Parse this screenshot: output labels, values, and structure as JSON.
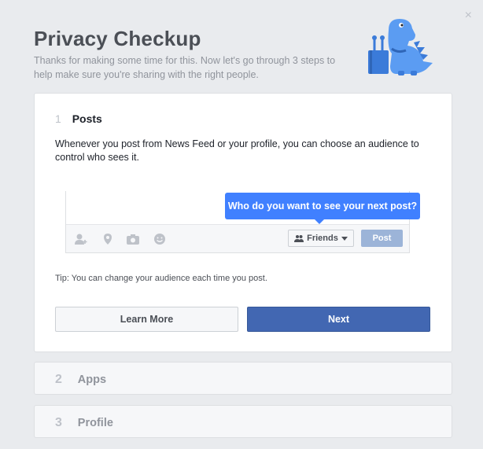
{
  "dialog": {
    "title": "Privacy Checkup",
    "subtitle": "Thanks for making some time for this. Now let's go through 3 steps to help make sure you're sharing with the right people.",
    "close_icon": "×"
  },
  "steps": [
    {
      "number": "1",
      "name": "Posts",
      "description": "Whenever you post from News Feed or your profile, you can choose an audience to control who sees it.",
      "tooltip": "Who do you want to see your next post?",
      "audience_label": "Friends",
      "post_label": "Post",
      "tip": "Tip: You can change your audience each time you post.",
      "learn_more_label": "Learn More",
      "next_label": "Next"
    },
    {
      "number": "2",
      "name": "Apps"
    },
    {
      "number": "3",
      "name": "Profile"
    }
  ],
  "composer_icons": [
    "tag-friends-icon",
    "location-icon",
    "camera-icon",
    "feeling-icon"
  ],
  "colors": {
    "accent": "#4267b2",
    "tooltip": "#4080ff",
    "post_disabled": "#9cb4d8",
    "mascot": "#4a90e2"
  }
}
